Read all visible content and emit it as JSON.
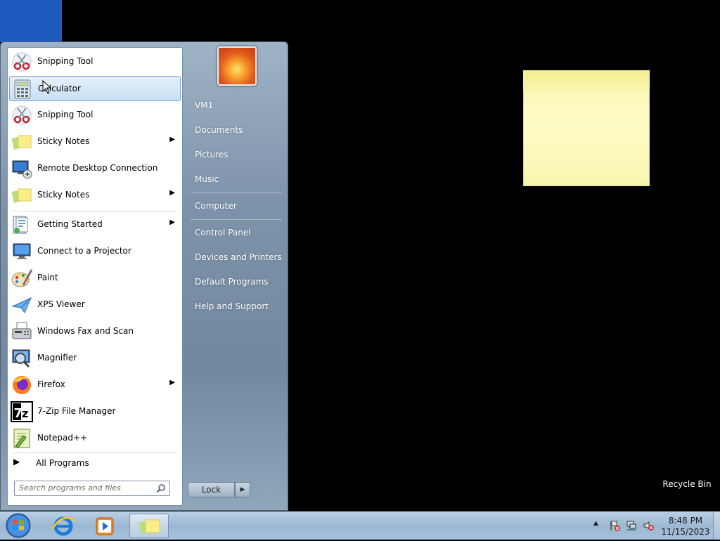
{
  "desktop": {
    "recycle_bin_label": "Recycle Bin"
  },
  "start_menu": {
    "programs": [
      {
        "label": "Snipping Tool",
        "icon": "scissors-icon",
        "arrow": false
      },
      {
        "label": "Calculator",
        "icon": "calculator-icon",
        "arrow": false,
        "highlighted": true
      },
      {
        "label": "Snipping Tool",
        "icon": "scissors-icon",
        "arrow": false
      },
      {
        "label": "Sticky Notes",
        "icon": "sticky-notes-icon",
        "arrow": true
      },
      {
        "label": "Remote Desktop Connection",
        "icon": "remote-desktop-icon",
        "arrow": false
      },
      {
        "label": "Sticky Notes",
        "icon": "sticky-notes-icon",
        "arrow": true
      },
      {
        "label": "Getting Started",
        "icon": "getting-started-icon",
        "arrow": true
      },
      {
        "label": "Connect to a Projector",
        "icon": "projector-icon",
        "arrow": false
      },
      {
        "label": "Paint",
        "icon": "paint-icon",
        "arrow": false
      },
      {
        "label": "XPS Viewer",
        "icon": "xps-viewer-icon",
        "arrow": false
      },
      {
        "label": "Windows Fax and Scan",
        "icon": "fax-scan-icon",
        "arrow": false
      },
      {
        "label": "Magnifier",
        "icon": "magnifier-icon",
        "arrow": false
      },
      {
        "label": "Firefox",
        "icon": "firefox-icon",
        "arrow": true
      },
      {
        "label": "7-Zip File Manager",
        "icon": "7zip-icon",
        "arrow": false
      },
      {
        "label": "Notepad++",
        "icon": "notepadpp-icon",
        "arrow": false
      }
    ],
    "all_programs_label": "All Programs",
    "search_placeholder": "Search programs and files",
    "right_items": [
      "VM1",
      "Documents",
      "Pictures",
      "Music",
      "Computer",
      "Control Panel",
      "Devices and Printers",
      "Default Programs",
      "Help and Support"
    ],
    "lock_label": "Lock"
  },
  "taskbar": {
    "clock_time": "8:48 PM",
    "clock_date": "11/15/2023",
    "pinned": [
      "internet-explorer-icon",
      "media-player-icon",
      "sticky-notes-icon"
    ]
  }
}
